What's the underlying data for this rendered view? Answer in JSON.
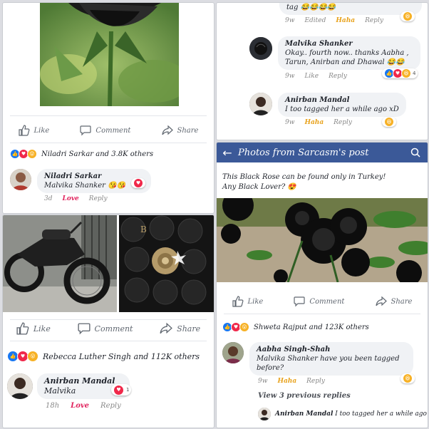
{
  "actions": {
    "like": "Like",
    "comment": "Comment",
    "share": "Share"
  },
  "panel1": {
    "reactions_summary": "Niladri Sarkar and 3.8K others",
    "comment": {
      "name": "Niladri Sarkar",
      "text": "Malvika Shanker",
      "emoji": "😘😘",
      "time": "3d",
      "reaction": "Love",
      "reply": "Reply"
    }
  },
  "panel2": {
    "top_comment": {
      "text": "tag 😂😂😂😂",
      "time": "9w",
      "edited": "Edited",
      "reaction": "Haha",
      "reply": "Reply"
    },
    "comment1": {
      "name": "Malvika Shanker",
      "text": "Okay.. fourth now.. thanks Aabha , Tarun, Anirban and Dhawal 😂😂",
      "time": "9w",
      "like": "Like",
      "reply": "Reply",
      "count": "4"
    },
    "comment2": {
      "name": "Anirban Mandal",
      "text": "I too tagged her a while ago xD",
      "time": "9w",
      "reaction": "Haha",
      "reply": "Reply"
    }
  },
  "panel3": {
    "reactions_summary": "Rebecca Luther Singh and 112K others",
    "comment": {
      "name": "Anirban Mandal",
      "text": "Malvika",
      "time": "18h",
      "reaction": "Love",
      "reply": "Reply",
      "count": "1"
    }
  },
  "panel4": {
    "header_title": "Photos from Sarcasm's post",
    "caption_line1": "This Black Rose can be found only in Turkey!",
    "caption_line2": "Any Black Lover? 😍",
    "reactions_summary": "Shweta Rajput and 123K others",
    "comment": {
      "name": "Aabha Singh-Shah",
      "text": "Malvika Shanker have you been tagged before?",
      "time": "9w",
      "reaction": "Haha",
      "reply": "Reply"
    },
    "view_previous": "View 3 previous replies",
    "reply_preview": {
      "name": "Anirban Mandal",
      "text": "I too tagged her a while ago xD"
    }
  },
  "colors": {
    "facebook_blue": "#3b5998",
    "haha": "#e8a21c",
    "love": "#e0245e"
  }
}
